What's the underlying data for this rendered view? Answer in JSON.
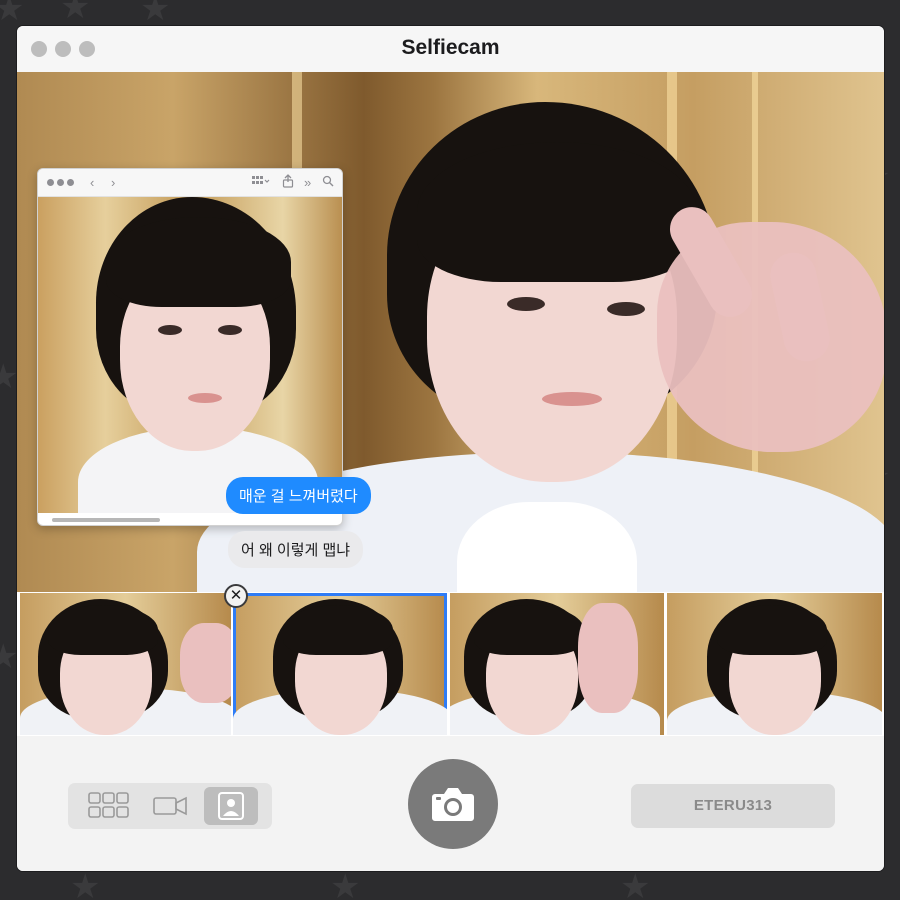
{
  "app": {
    "title": "Selfiecam"
  },
  "chat": {
    "sent": "매운 걸 느껴버렸다",
    "received": "어 왜 이렇게 맵냐"
  },
  "mini_window": {
    "icons": [
      "back-icon",
      "forward-icon",
      "grid-view-icon",
      "share-icon",
      "more-icon",
      "search-icon"
    ]
  },
  "filmstrip": {
    "count": 4,
    "selected_index": 1,
    "remove_glyph": "✕"
  },
  "controls": {
    "modes": [
      "grid-mode",
      "video-mode",
      "photo-mode"
    ],
    "active_mode": "photo-mode",
    "user_label": "ETERU313"
  },
  "colors": {
    "accent": "#2e7cf6",
    "bubble_sent": "#1f8bff",
    "bubble_received": "#eaeaec",
    "shutter": "#7a7a7a"
  }
}
